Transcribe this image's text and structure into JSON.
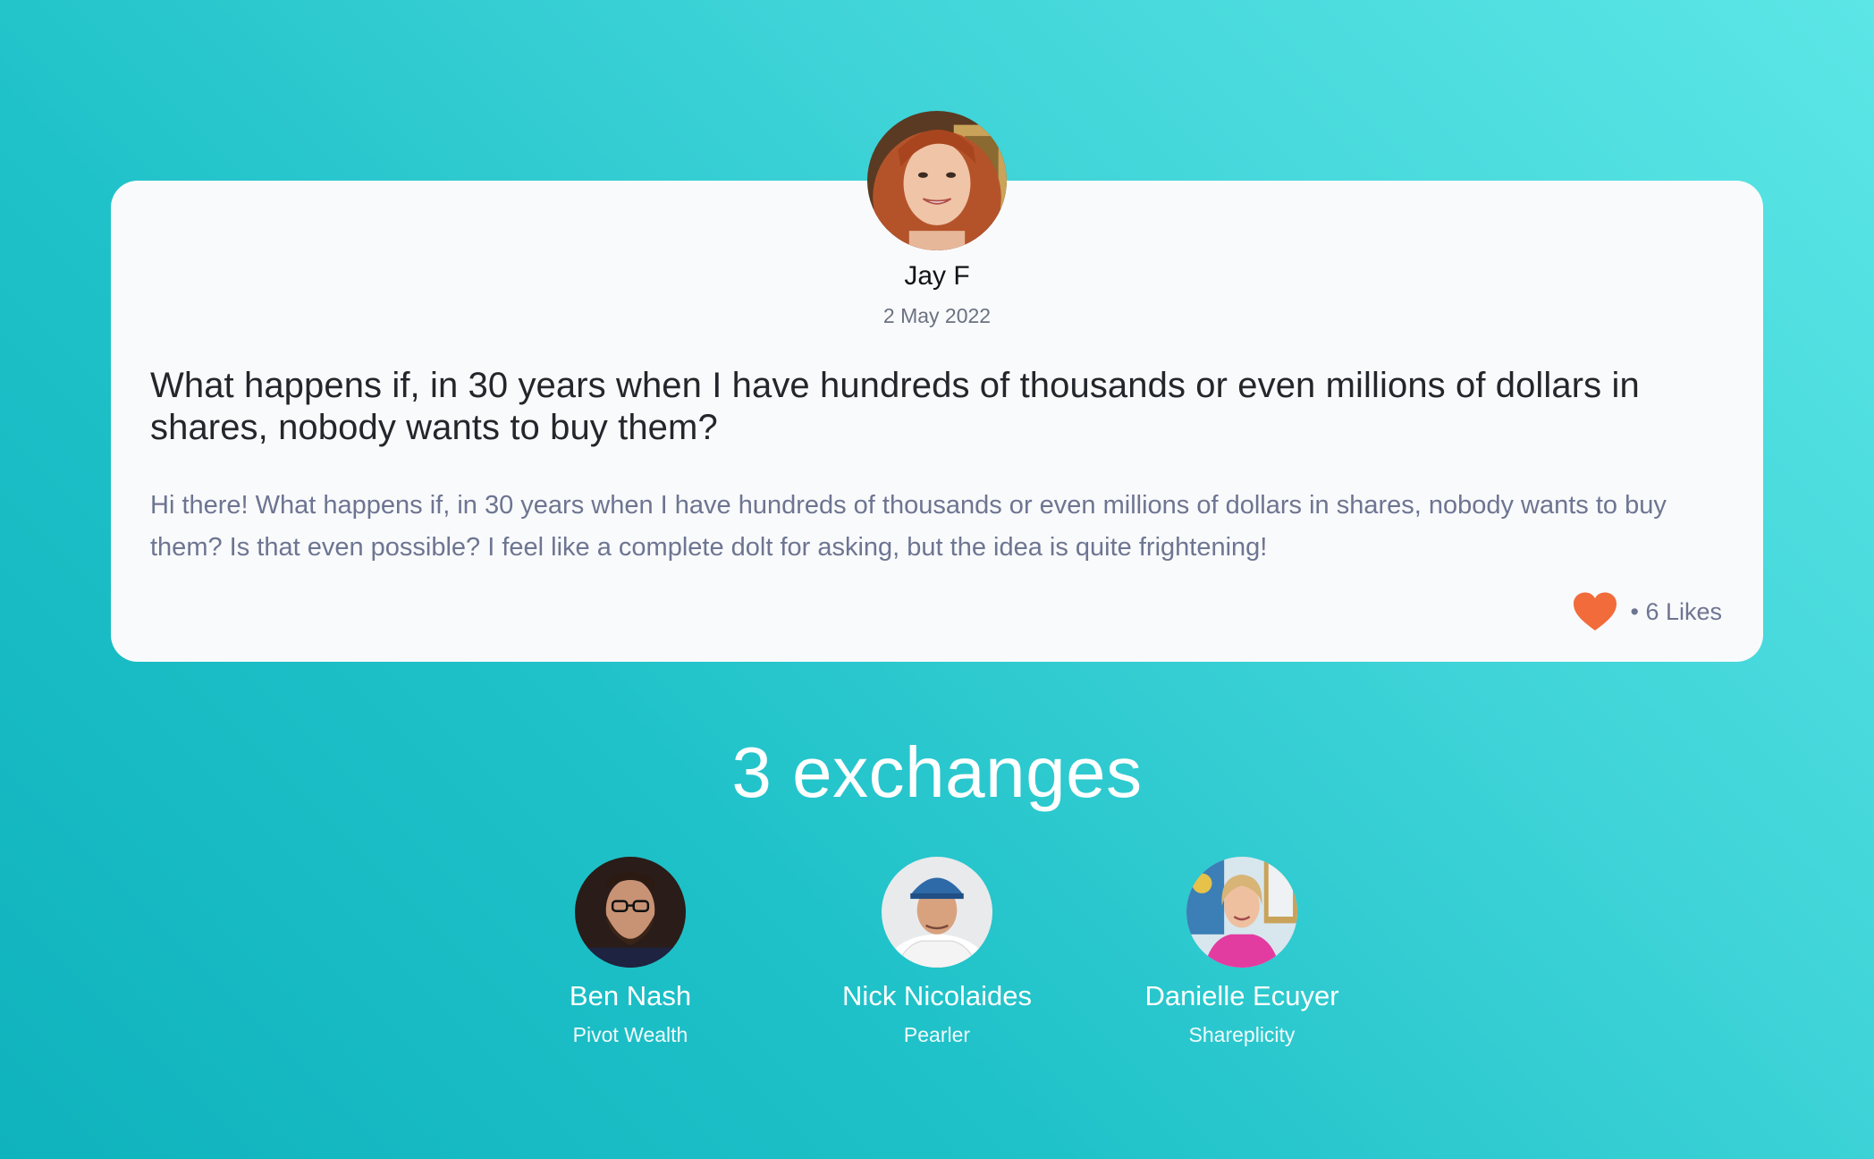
{
  "post": {
    "author_name": "Jay F",
    "date": "2 May 2022",
    "title": "What happens if, in 30 years when I have hundreds of thousands or even millions of dollars in shares, nobody wants to buy them?",
    "body": "Hi there! What happens if, in 30 years when I have hundreds of thousands or even millions of dollars in shares, nobody wants to buy them? Is that even possible? I feel like a complete dolt for asking, but the idea is quite frightening!",
    "likes_label": "• 6 Likes",
    "likes_count": 6,
    "like_icon": "heart-icon",
    "like_color": "#f26b3a"
  },
  "exchanges": {
    "title": "3 exchanges",
    "experts": [
      {
        "name": "Ben Nash",
        "company": "Pivot Wealth"
      },
      {
        "name": "Nick Nicolaides",
        "company": "Pearler"
      },
      {
        "name": "Danielle Ecuyer",
        "company": "Shareplicity"
      }
    ]
  },
  "colors": {
    "background_light": "#5ce6e6",
    "background_dark": "#0fb3bd",
    "card": "#f9fafc",
    "muted_text": "#6d7591"
  }
}
